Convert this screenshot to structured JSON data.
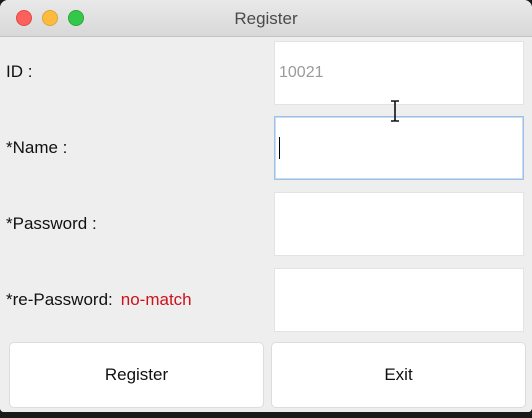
{
  "window": {
    "title": "Register"
  },
  "form": {
    "id": {
      "label": "ID :",
      "value": "10021"
    },
    "name": {
      "label": "*Name :",
      "value": ""
    },
    "password": {
      "label": "*Password :",
      "value": ""
    },
    "repassword": {
      "label": "*re-Password:",
      "status": "no-match",
      "value": ""
    }
  },
  "buttons": {
    "register_label": "Register",
    "exit_label": "Exit"
  },
  "colors": {
    "warning": "#d0101a",
    "focus_border": "#9ec1e6"
  }
}
